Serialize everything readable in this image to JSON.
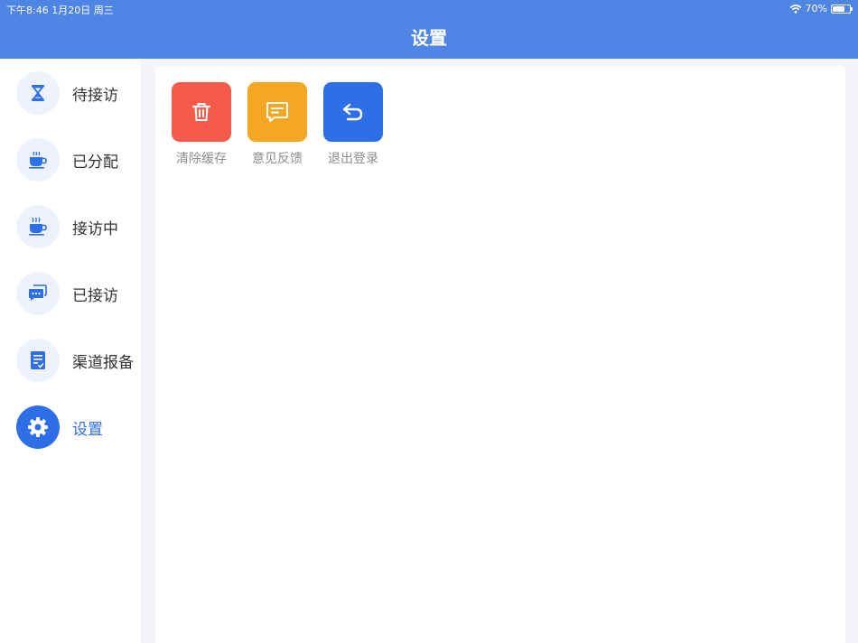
{
  "status_bar": {
    "time": "下午8:46  1月20日 周三",
    "battery": "70%"
  },
  "header": {
    "title": "设置"
  },
  "sidebar": {
    "items": [
      {
        "label": "待接访",
        "icon": "hourglass-icon",
        "active": false
      },
      {
        "label": "已分配",
        "icon": "coffee-cup-icon",
        "active": false
      },
      {
        "label": "接访中",
        "icon": "steaming-cup-icon",
        "active": false
      },
      {
        "label": "已接访",
        "icon": "chat-bubbles-icon",
        "active": false
      },
      {
        "label": "渠道报备",
        "icon": "document-check-icon",
        "active": false
      },
      {
        "label": "设置",
        "icon": "gear-icon",
        "active": true
      }
    ]
  },
  "actions": [
    {
      "label": "清除缓存",
      "icon": "trash-icon",
      "color": "#f45b4a"
    },
    {
      "label": "意见反馈",
      "icon": "feedback-icon",
      "color": "#f5a623"
    },
    {
      "label": "退出登录",
      "icon": "logout-icon",
      "color": "#2e6ee6"
    }
  ],
  "colors": {
    "accent": "#4f85e4",
    "active": "#2e6ee6",
    "icon_bg": "#edf2fd"
  }
}
